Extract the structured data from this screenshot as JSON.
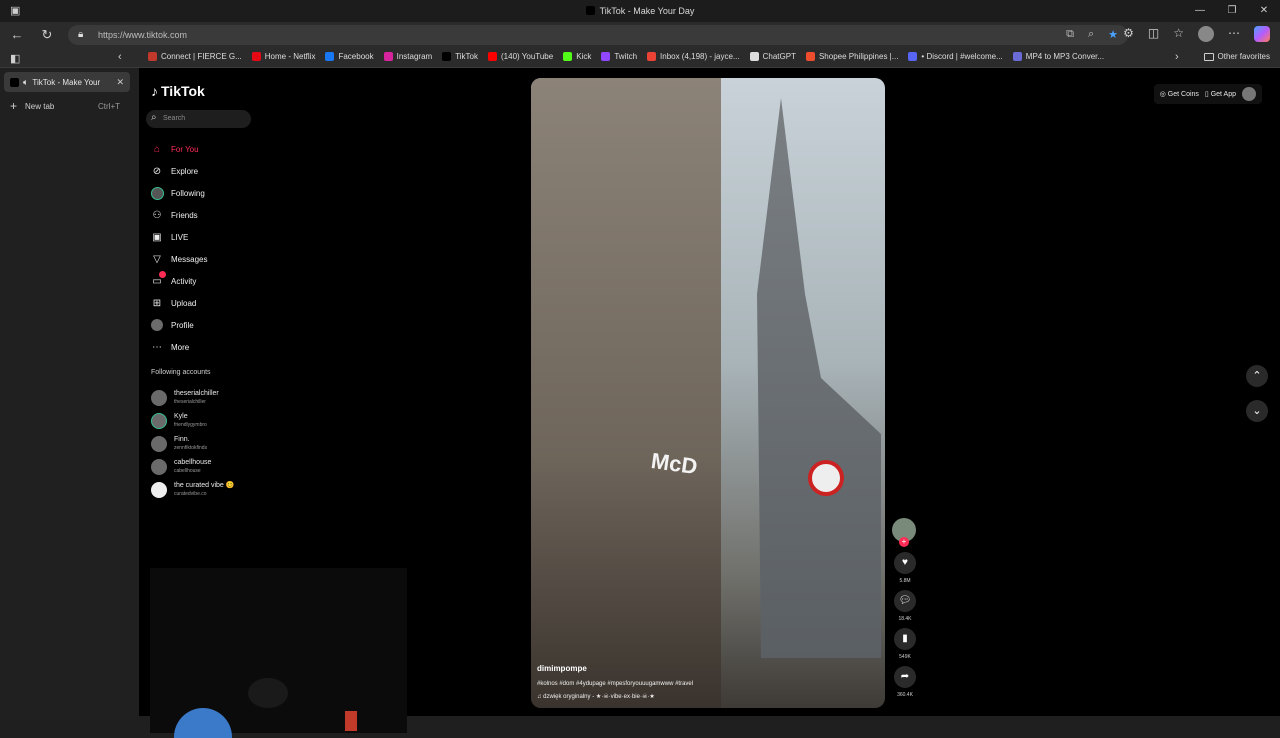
{
  "window": {
    "title": "TikTok - Make Your Day"
  },
  "address": {
    "url": "https://www.tiktok.com"
  },
  "favorites": [
    {
      "label": "Connect | FIERCE G...",
      "color": "#c0392b"
    },
    {
      "label": "Home - Netflix",
      "color": "#e50914"
    },
    {
      "label": "Facebook",
      "color": "#1877f2"
    },
    {
      "label": "Instagram",
      "color": "#d6249f"
    },
    {
      "label": "TikTok",
      "color": "#000000"
    },
    {
      "label": "(140) YouTube",
      "color": "#ff0000"
    },
    {
      "label": "Kick",
      "color": "#53fc18"
    },
    {
      "label": "Twitch",
      "color": "#9146ff"
    },
    {
      "label": "Inbox (4,198) - jayce...",
      "color": "#ea4335"
    },
    {
      "label": "ChatGPT",
      "color": "#dddddd"
    },
    {
      "label": "Shopee Philippines |...",
      "color": "#ee4d2d"
    },
    {
      "label": "• Discord | #welcome...",
      "color": "#5865f2"
    },
    {
      "label": "MP4 to MP3 Conver...",
      "color": "#6b6bd6"
    }
  ],
  "other_favorites": "Other favorites",
  "tabs": {
    "active": "TikTok - Make Your",
    "new_tab": "New tab",
    "new_tab_shortcut": "Ctrl+T"
  },
  "tiktok": {
    "logo": "TikTok",
    "search_placeholder": "Search",
    "menu": [
      {
        "label": "For You",
        "icon": "home-icon"
      },
      {
        "label": "Explore",
        "icon": "compass-icon"
      },
      {
        "label": "Following",
        "icon": "avatar-icon"
      },
      {
        "label": "Friends",
        "icon": "friends-icon"
      },
      {
        "label": "LIVE",
        "icon": "live-icon"
      },
      {
        "label": "Messages",
        "icon": "messages-icon"
      },
      {
        "label": "Activity",
        "icon": "activity-icon"
      },
      {
        "label": "Upload",
        "icon": "upload-icon"
      },
      {
        "label": "Profile",
        "icon": "profile-icon"
      },
      {
        "label": "More",
        "icon": "more-icon"
      }
    ],
    "following_heading": "Following accounts",
    "accounts": [
      {
        "name": "theserialchiller",
        "handle": "theserialchiller"
      },
      {
        "name": "Kyle",
        "handle": "friendlygymbro"
      },
      {
        "name": "Finn.",
        "handle": "zennfiktokfinds"
      },
      {
        "name": "cabellhouse",
        "handle": "cabellhouse"
      },
      {
        "name": "the curated vibe 😊",
        "handle": "curatedvibe.co"
      }
    ],
    "top_right": {
      "coins": "Get Coins",
      "app": "Get App"
    },
    "video": {
      "username": "dimimpompe",
      "description": "#kolnos #dom #4ydupage #mpesforyouuugamwww #travel",
      "music": "♫  dzwięk oryginalny - ★·☠·vibe·ex·bie·☠·★",
      "storefront_text": "McD"
    },
    "actions": {
      "likes": "5.8M",
      "comments": "18.4K",
      "saves": "549K",
      "shares": "360.4K"
    }
  }
}
